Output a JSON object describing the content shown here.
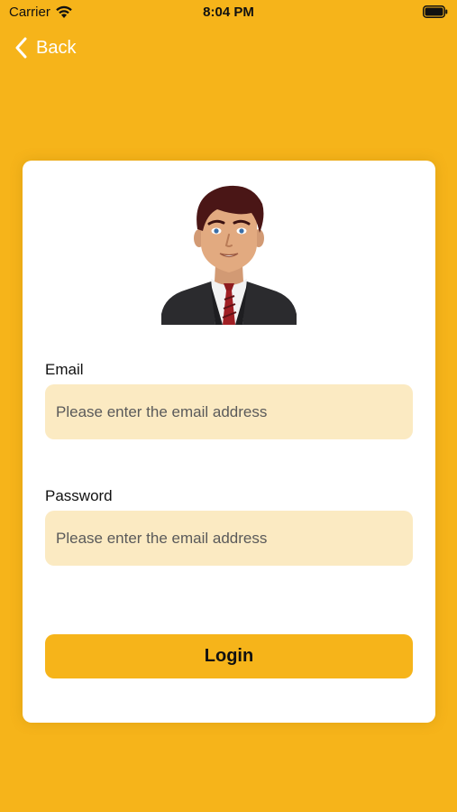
{
  "status_bar": {
    "carrier": "Carrier",
    "time": "8:04 PM",
    "wifi_icon": "wifi-icon",
    "battery_icon": "battery-icon"
  },
  "nav": {
    "back_label": "Back",
    "back_icon": "chevron-left-icon"
  },
  "form": {
    "avatar_icon": "businessman-avatar",
    "email_label": "Email",
    "email_placeholder": "Please enter the email address",
    "email_value": "",
    "password_label": "Password",
    "password_placeholder": "Please enter the email address",
    "password_value": "",
    "login_label": "Login"
  },
  "colors": {
    "background": "#F6B41A",
    "card": "#FFFFFF",
    "input_fill": "#FBEAC2",
    "button": "#F6B41A",
    "text": "#111111"
  }
}
